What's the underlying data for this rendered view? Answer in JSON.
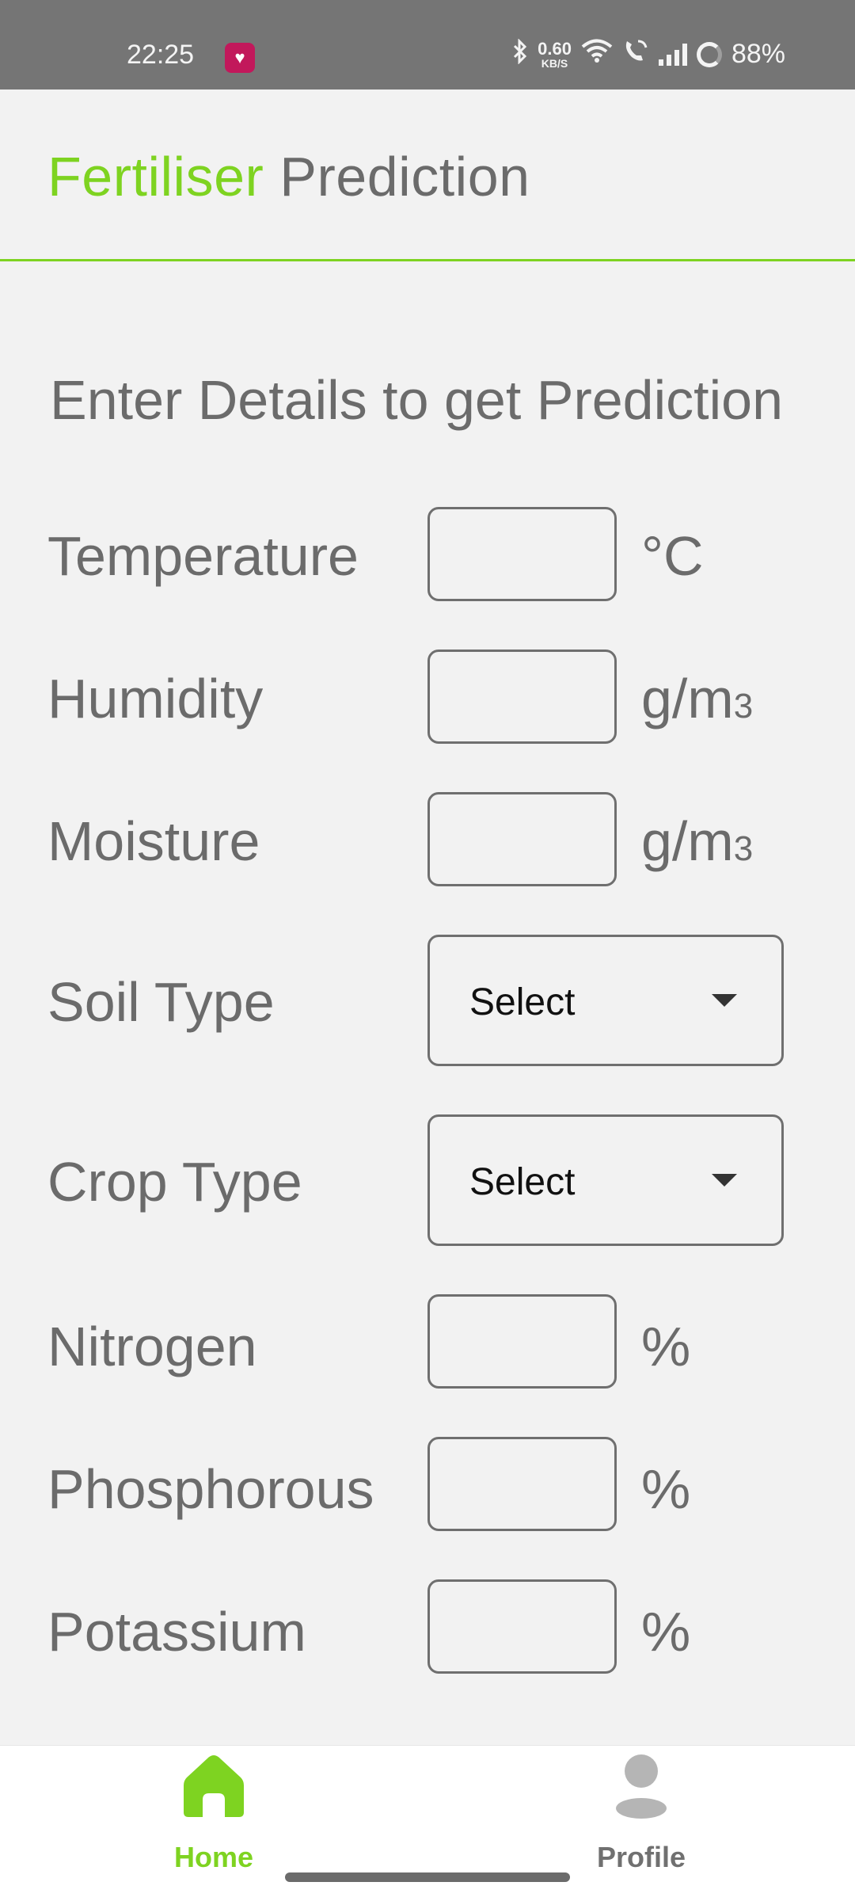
{
  "status_bar": {
    "time": "22:25",
    "net_speed_value": "0.60",
    "net_speed_unit": "KB/S",
    "battery": "88%",
    "icons": [
      "notification-app-icon",
      "bluetooth-icon",
      "wifi-icon",
      "wifi-calling-icon",
      "signal-icon",
      "battery-icon"
    ]
  },
  "header": {
    "title_accent": "Fertiliser",
    "title_rest": " Prediction",
    "accent_color": "#7ed321"
  },
  "form": {
    "heading": "Enter Details to get Prediction",
    "fields": {
      "temperature": {
        "label": "Temperature",
        "value": "",
        "unit": "°C"
      },
      "humidity": {
        "label": "Humidity",
        "value": "",
        "unit": "g/m",
        "unit_sub": "3"
      },
      "moisture": {
        "label": "Moisture",
        "value": "",
        "unit": "g/m",
        "unit_sub": "3"
      },
      "soil_type": {
        "label": "Soil Type",
        "selected": "Select"
      },
      "crop_type": {
        "label": "Crop Type",
        "selected": "Select"
      },
      "nitrogen": {
        "label": "Nitrogen",
        "value": "",
        "unit": "%"
      },
      "phosphorous": {
        "label": "Phosphorous",
        "value": "",
        "unit": "%"
      },
      "potassium": {
        "label": "Potassium",
        "value": "",
        "unit": "%"
      }
    }
  },
  "bottom_nav": {
    "items": [
      {
        "label": "Home",
        "icon": "home-icon",
        "active": true
      },
      {
        "label": "Profile",
        "icon": "profile-icon",
        "active": false
      }
    ]
  }
}
